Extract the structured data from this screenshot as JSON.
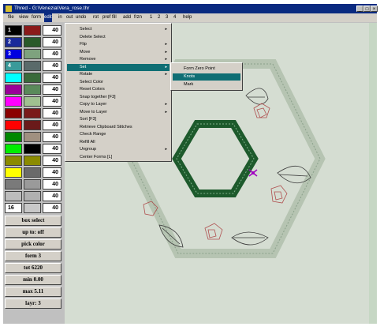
{
  "window": {
    "title": "Thred - G:\\Venezia\\Vera_rose.thr"
  },
  "menubar": {
    "items": [
      "file",
      "view",
      "form",
      "edit",
      "in",
      "out",
      "undo",
      "rot",
      "pref",
      "fill",
      "add",
      "frzn",
      "1",
      "2",
      "3",
      "4",
      "help"
    ]
  },
  "color_panel": {
    "rows": [
      {
        "label": "1",
        "color1": "#000000",
        "color2": "#8b1a1a",
        "value": "40"
      },
      {
        "label": "2",
        "color1": "#1a2a9a",
        "color2": "#2a5a2a",
        "value": "40"
      },
      {
        "label": "3",
        "color1": "#0000e0",
        "color2": "#7ea27e",
        "value": "40"
      },
      {
        "label": "4",
        "color1": "#3a9a9a",
        "color2": "#5a6a6a",
        "value": "40"
      },
      {
        "label": "",
        "color1": "#00ffff",
        "color2": "#3a6a3a",
        "value": "40"
      },
      {
        "label": "",
        "color1": "#9a0099",
        "color2": "#5a8a5a",
        "value": "40"
      },
      {
        "label": "",
        "color1": "#ff00ff",
        "color2": "#a0c090",
        "value": "40"
      },
      {
        "label": "",
        "color1": "#8b0000",
        "color2": "#7a1a1a",
        "value": "40"
      },
      {
        "label": "",
        "color1": "#ff0000",
        "color2": "#6a1a1a",
        "value": "40"
      },
      {
        "label": "",
        "color1": "#008800",
        "color2": "#a09080",
        "value": "40"
      },
      {
        "label": "",
        "color1": "#00ee00",
        "color2": "#000000",
        "value": "40"
      },
      {
        "label": "",
        "color1": "#8b8b00",
        "color2": "#8b8b00",
        "value": "40"
      },
      {
        "label": "",
        "color1": "#ffff00",
        "color2": "#6a6a6a",
        "value": "40"
      },
      {
        "label": "",
        "color1": "#7a7a7a",
        "color2": "#9a9a9a",
        "value": "40"
      },
      {
        "label": "",
        "color1": "#bcbcbc",
        "color2": "#b0b0b0",
        "value": "40"
      },
      {
        "label": "16",
        "color1": "#ffffff",
        "color2": "#c8c8c8",
        "value": "40"
      }
    ],
    "buttons": [
      "box select",
      "up to: off",
      "pick color",
      "form 3",
      "tot 6220",
      "min 0.00",
      "max 5.11",
      "layr: 3"
    ]
  },
  "edit_menu": {
    "items": [
      {
        "label": "Select",
        "has_submenu": true
      },
      {
        "label": "Delete Select",
        "has_submenu": false
      },
      {
        "label": "Flip",
        "has_submenu": true
      },
      {
        "label": "Move",
        "has_submenu": true
      },
      {
        "label": "Remove",
        "has_submenu": true
      },
      {
        "label": "Set",
        "has_submenu": true
      },
      {
        "label": "Rotate",
        "has_submenu": true
      },
      {
        "label": "Select Color",
        "has_submenu": false
      },
      {
        "label": "Reset Colors",
        "has_submenu": false
      },
      {
        "label": "Snap together [F3]",
        "has_submenu": false
      },
      {
        "label": "Copy to Layer",
        "has_submenu": true
      },
      {
        "label": "Move to Layer",
        "has_submenu": true
      },
      {
        "label": "Sort [F3]",
        "has_submenu": false
      },
      {
        "label": "Retrieve Clipboard Stitches",
        "has_submenu": false
      },
      {
        "label": "Check Range",
        "has_submenu": false
      },
      {
        "label": "Refill All",
        "has_submenu": false
      },
      {
        "label": "Ungroup",
        "has_submenu": true
      },
      {
        "label": "Center Forms [L]",
        "has_submenu": false
      }
    ]
  },
  "set_submenu": {
    "items": [
      "Form Zero Point",
      "Knots",
      "Mark"
    ]
  },
  "colors": {
    "title_bar": "#0a2a80",
    "highlight": "#0f6e74",
    "canvas": "#d5ddd2",
    "hex_outer": "#b6c4b2",
    "hex_inner": "#255a32"
  }
}
